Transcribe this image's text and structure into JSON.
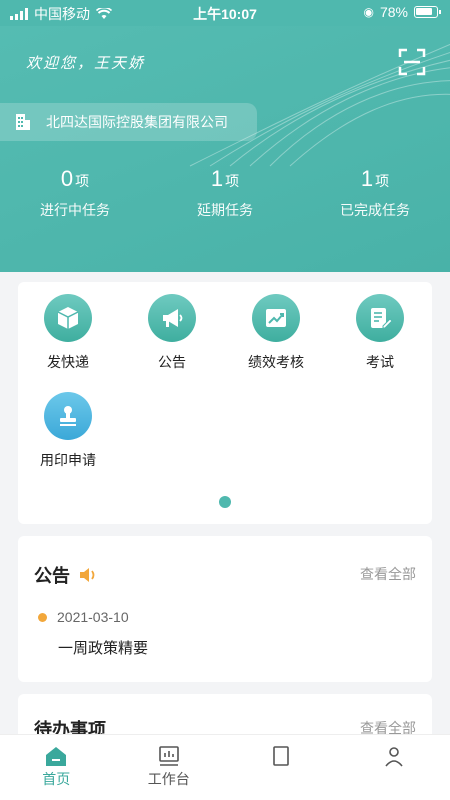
{
  "status_bar": {
    "carrier": "中国移动",
    "time": "上午10:07",
    "battery": "78%"
  },
  "header": {
    "welcome": "欢迎您，王天娇",
    "company": "北四达国际控股集团有限公司",
    "stats": [
      {
        "num": "0",
        "unit": "项",
        "label": "进行中任务"
      },
      {
        "num": "1",
        "unit": "项",
        "label": "延期任务"
      },
      {
        "num": "1",
        "unit": "项",
        "label": "已完成任务"
      }
    ]
  },
  "apps": [
    {
      "label": "发快递",
      "icon": "package-icon"
    },
    {
      "label": "公告",
      "icon": "megaphone-icon"
    },
    {
      "label": "绩效考核",
      "icon": "performance-chart-icon"
    },
    {
      "label": "考试",
      "icon": "exam-edit-icon"
    },
    {
      "label": "用印申请",
      "icon": "seal-stamp-icon"
    }
  ],
  "notice": {
    "title": "公告",
    "more": "查看全部",
    "items": [
      {
        "date": "2021-03-10",
        "text": "一周政策精要"
      }
    ]
  },
  "todo": {
    "title": "待办事项",
    "more": "查看全部"
  },
  "tabbar": {
    "tabs": [
      {
        "label": "首页"
      },
      {
        "label": "工作台"
      }
    ]
  },
  "colors": {
    "brand": "#4fb8ae",
    "accent_orange": "#f2a73b",
    "stamp_blue": "#3ba8d8"
  }
}
